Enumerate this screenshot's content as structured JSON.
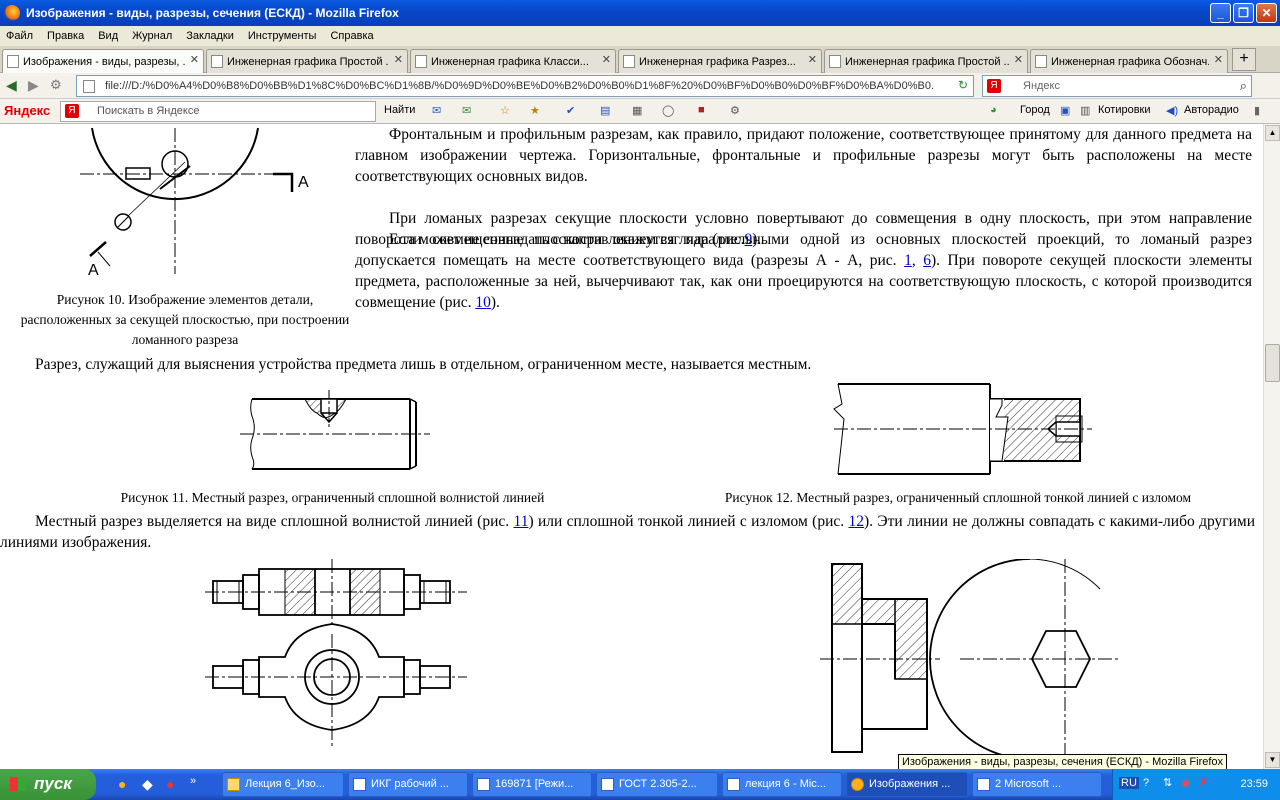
{
  "window": {
    "title": "Изображения - виды, разрезы, сечения (ЕСКД) - Mozilla Firefox"
  },
  "menu": [
    "Файл",
    "Правка",
    "Вид",
    "Журнал",
    "Закладки",
    "Инструменты",
    "Справка"
  ],
  "tabs": [
    {
      "label": "Изображения - виды, разрезы, ..."
    },
    {
      "label": "Инженерная графика Простой ..."
    },
    {
      "label": "Инженерная графика Класси..."
    },
    {
      "label": "Инженерная графика Разрез..."
    },
    {
      "label": "Инженерная графика Простой ..."
    },
    {
      "label": "Инженерная графика Обознач..."
    }
  ],
  "nav": {
    "url": "file:///D:/%D0%A4%D0%B8%D0%BB%D1%8C%D0%BC%D1%8B/%D0%9D%D0%BE%D0%B2%D0%B0%D1%8F%20%D0%BF%D0%B0%D0%BF%D0%BA%D0%B0.",
    "search_placeholder": "Яндекс"
  },
  "yandex": {
    "logo": "Яндекс",
    "search_placeholder": "Поискать в Яндексе",
    "find": "Найти",
    "city": "Город",
    "quotes": "Котировки",
    "radio": "Авторадио"
  },
  "content": {
    "p1": "Фронтальным и профильным разрезам, как правило, придают положение, соответствующее принятому для данного предмета на главном изображении чертежа. Горизонтальные, фронтальные и профильные разрезы могут быть расположены на месте соответствующих основных видов.",
    "p2a": "При ломаных разрезах секущие плоскости условно повертывают до совмещения в одну плоскость, при этом направление поворота может не совпадать с направлением взгляда (рис.",
    "p2link": "9",
    "p2b": ").",
    "p3a": "Если совмещенные плоскости окажутся параллельными одной из основных плоскостей проекций, то ломаный разрез допускается помещать на месте соответствующего вида (разрезы А - А, рис.",
    "p3l1": "1",
    "p3l2": "6",
    "p3b": "). При повороте секущей плоскости элементы предмета, расположенные за ней, вычерчивают так, как они проецируются на соответствующую плоскость, с которой производится совмещение (рис.",
    "p3l3": "10",
    "p3c": ").",
    "cap10": "Рисунок 10. Изображение элементов детали, расположенных за секущей плоскостью, при построении ломанного разреза",
    "fig10_label": "А",
    "p4": "Разрез, служащий для выяснения устройства предмета лишь в отдельном, ограниченном месте, называется местным.",
    "cap11": "Рисунок 11. Местный разрез, ограниченный сплошной волнистой линией",
    "cap12": "Рисунок 12. Местный разрез, ограниченный сплошной тонкой линией с изломом",
    "p5a": "Местный разрез выделяется на виде сплошной волнистой линией (рис.",
    "p5l1": "11",
    "p5b": ") или сплошной тонкой линией с изломом (рис.",
    "p5l2": "12",
    "p5c": "). Эти линии не должны совпадать с какими-либо другими линиями изображения."
  },
  "tooltip": "Изображения - виды, разрезы, сечения (ЕСКД) - Mozilla Firefox",
  "taskbar": {
    "start": "пуск",
    "items": [
      "Лекция 6_Изо...",
      "ИКГ рабочий ...",
      "169871 [Режи...",
      "ГОСТ 2.305-2...",
      "лекция 6 - Mic...",
      "Изображения ...",
      "2 Microsoft ..."
    ],
    "lang": "RU",
    "clock": "23:59"
  }
}
